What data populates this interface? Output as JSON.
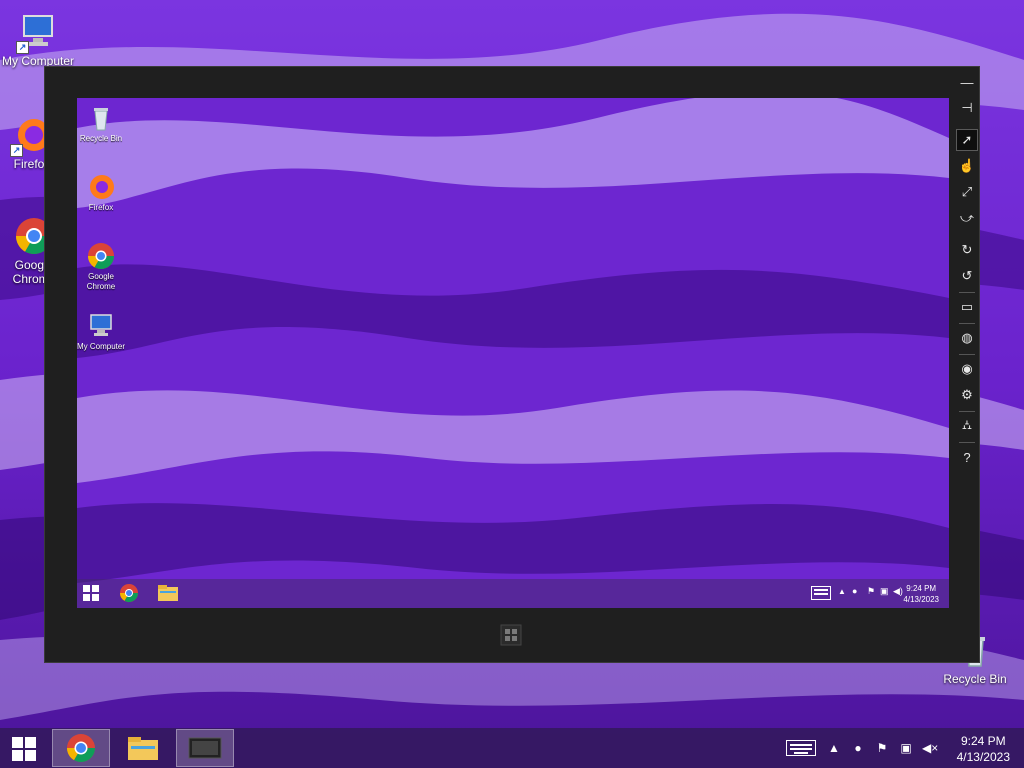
{
  "desktop": {
    "icons": [
      {
        "label": "My Computer"
      },
      {
        "label": "Firefox"
      },
      {
        "label": "Google Chrome"
      },
      {
        "label": "Recycle Bin"
      }
    ]
  },
  "simulator": {
    "toolbar": [
      {
        "name": "minimize-icon",
        "glyph": "—"
      },
      {
        "name": "pin-icon",
        "glyph": "⊣"
      },
      {
        "name": "mouse-mode-icon",
        "glyph": "➚"
      },
      {
        "name": "touch-mode-icon",
        "glyph": "☝"
      },
      {
        "name": "pinch-zoom-icon",
        "glyph": "⤢"
      },
      {
        "name": "rotation-touch-icon",
        "glyph": "↻"
      },
      {
        "name": "rotate-clockwise-icon",
        "glyph": "↻"
      },
      {
        "name": "rotate-counterclockwise-icon",
        "glyph": "↺"
      },
      {
        "name": "change-resolution-icon",
        "glyph": "▭"
      },
      {
        "name": "set-location-icon",
        "glyph": "◍"
      },
      {
        "name": "screenshot-icon",
        "glyph": "◉"
      },
      {
        "name": "screenshot-settings-icon",
        "glyph": "⚙"
      },
      {
        "name": "network-icon",
        "glyph": "⛼"
      },
      {
        "name": "help-icon",
        "glyph": "?"
      }
    ],
    "desktop_icons": [
      {
        "label": "Recycle Bin"
      },
      {
        "label": "Firefox"
      },
      {
        "label": "Google Chrome"
      },
      {
        "label": "My Computer"
      }
    ],
    "clock": {
      "time": "9:24 PM",
      "date": "4/13/2023"
    }
  },
  "taskbar": {
    "clock": {
      "time": "9:24 PM",
      "date": "4/13/2023"
    },
    "apps": [
      {
        "name": "chrome"
      },
      {
        "name": "file-explorer"
      },
      {
        "name": "simulator"
      }
    ]
  },
  "colors": {
    "wallpaper_dark": "#3a0a82",
    "wallpaper_mid": "#7a2fe0",
    "wallpaper_light": "#d9c6ff",
    "frame": "#1f1f1f"
  }
}
